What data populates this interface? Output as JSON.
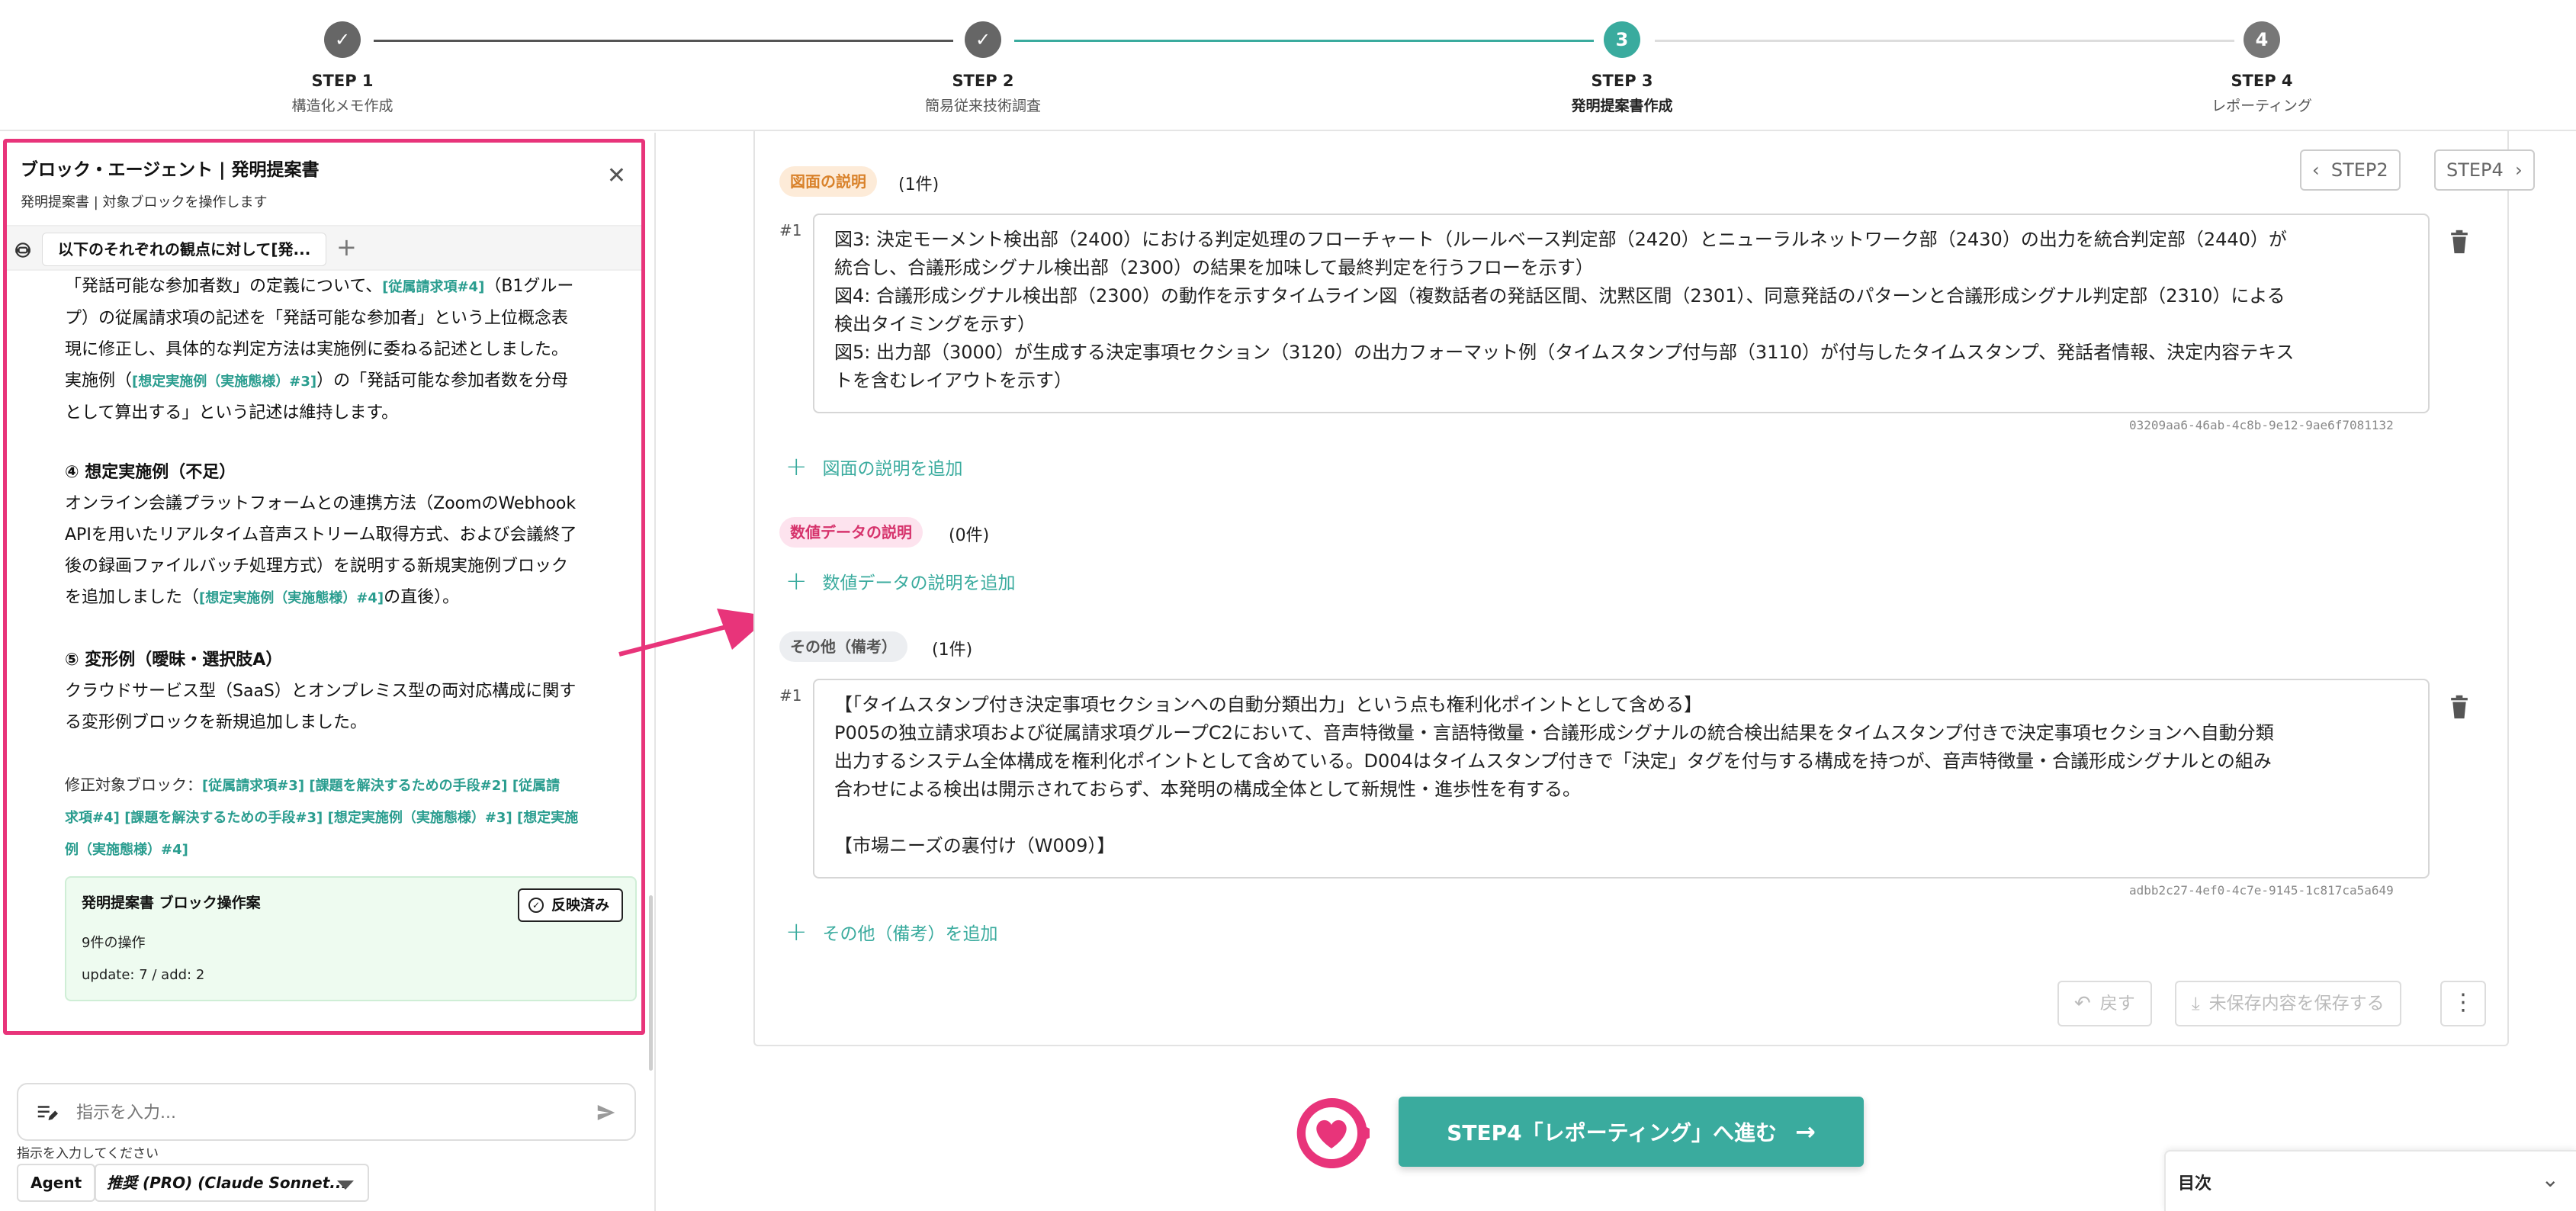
{
  "stepper": {
    "steps": [
      {
        "name": "STEP 1",
        "sub": "構造化メモ作成",
        "state": "done",
        "num": "✓"
      },
      {
        "name": "STEP 2",
        "sub": "簡易従来技術調査",
        "state": "done",
        "num": "✓"
      },
      {
        "name": "STEP 3",
        "sub": "発明提案書作成",
        "state": "active",
        "num": "3"
      },
      {
        "name": "STEP 4",
        "sub": "レポーティング",
        "state": "todo",
        "num": "4"
      }
    ]
  },
  "agent": {
    "title": "ブロック・エージェント | 発明提案書",
    "subtitle": "発明提案書 | 対象ブロックを操作します",
    "thread_tab": "以下のそれぞれの観点に対して[発...",
    "msg_top": {
      "l1a": "「発話可能な参加者数」の定義について、",
      "l1ref": "[従属請求項#4]",
      "l1b": "（B1グルー",
      "l2": "プ）の従属請求項の記述を「発話可能な参加者」という上位概念表",
      "l3": "現に修正し、具体的な判定方法は実施例に委ねる記述としました。",
      "l4a": "実施例（",
      "l4ref": "[想定実施例（実施態様）#3]",
      "l4b": "）の「発話可能な参加者数を分母",
      "l5": "として算出する」という記述は維持します。"
    },
    "sec4": {
      "heading": "④ 想定実施例（不足）",
      "l1": "オンライン会議プラットフォームとの連携方法（ZoomのWebhook",
      "l2": "APIを用いたリアルタイム音声ストリーム取得方式、および会議終了",
      "l3": "後の録画ファイルバッチ処理方式）を説明する新規実施例ブロック",
      "l4a": "を追加しました（",
      "l4ref": "[想定実施例（実施態様）#4]",
      "l4b": "の直後）。"
    },
    "sec5": {
      "heading": "⑤ 変形例（曖昧・選択肢A）",
      "l1": "クラウドサービス型（SaaS）とオンプレミス型の両対応構成に関す",
      "l2": "る変形例ブロックを新規追加しました。"
    },
    "modified": {
      "label": "修正対象ブロック：",
      "r1": "[従属請求項#3]",
      "r2": "[課題を解決するための手段#2]",
      "r3a": "[従属請",
      "r3b": "求項#4]",
      "r4": "[課題を解決するための手段#3]",
      "r5": "[想定実施例（実施態様）#3]",
      "r6a": "[想定実施",
      "r6b": "例（実施態様）#4]"
    },
    "op_card": {
      "title": "発明提案書 ブロック操作案",
      "applied": "反映済み",
      "count": "9件の操作",
      "detail": "update: 7 / add: 2"
    },
    "input_placeholder": "指示を入力...",
    "hint": "指示を入力してください",
    "mode": "Agent",
    "model": "推奨 (PRO) (Claude Sonnet..."
  },
  "nav": {
    "prev": "STEP2",
    "next": "STEP4"
  },
  "sections": {
    "figures": {
      "label": "図面の説明",
      "count": "(1件)",
      "row": "#1",
      "lines": [
        "図3: 決定モーメント検出部（2400）における判定処理のフローチャート（ルールベース判定部（2420）とニューラルネットワーク部（2430）の出力を統合判定部（2440）が",
        "統合し、合議形成シグナル検出部（2300）の結果を加味して最終判定を行うフローを示す）",
        "図4: 合議形成シグナル検出部（2300）の動作を示すタイムライン図（複数話者の発話区間、沈黙区間（2301）、同意発話のパターンと合議形成シグナル判定部（2310）による",
        "検出タイミングを示す）",
        "図5: 出力部（3000）が生成する決定事項セクション（3120）の出力フォーマット例（タイムスタンプ付与部（3110）が付与したタイムスタンプ、発話者情報、決定内容テキス",
        "トを含むレイアウトを示す）"
      ],
      "uuid": "03209aa6-46ab-4c8b-9e12-9ae6f7081132",
      "add": "図面の説明を追加"
    },
    "numeric": {
      "label": "数値データの説明",
      "count": "(0件)",
      "add": "数値データの説明を追加"
    },
    "other": {
      "label": "その他（備考）",
      "count": "(1件)",
      "row": "#1",
      "lines": [
        "【「タイムスタンプ付き決定事項セクションへの自動分類出力」という点も権利化ポイントとして含める】",
        "P005の独立請求項および従属請求項グループC2において、音声特徴量・言語特徴量・合議形成シグナルの統合検出結果をタイムスタンプ付きで決定事項セクションへ自動分類",
        "出力するシステム全体構成を権利化ポイントとして含めている。D004はタイムスタンプ付きで「決定」タグを付与する構成を持つが、音声特徴量・合議形成シグナルとの組み",
        "合わせによる検出は開示されておらず、本発明の構成全体として新規性・進歩性を有する。",
        "",
        "【市場ニーズの裏付け（W009）】"
      ],
      "uuid": "adbb2c27-4ef0-4c7e-9145-1c817ca5a649",
      "add": "その他（備考）を追加"
    }
  },
  "actions": {
    "undo": "戻す",
    "save": "未保存内容を保存する",
    "more": "⋮"
  },
  "next_step": "STEP4「レポーティング」へ進む",
  "toc": "目次",
  "colors": {
    "accent": "#3aab9e",
    "pink": "#e8347a"
  }
}
